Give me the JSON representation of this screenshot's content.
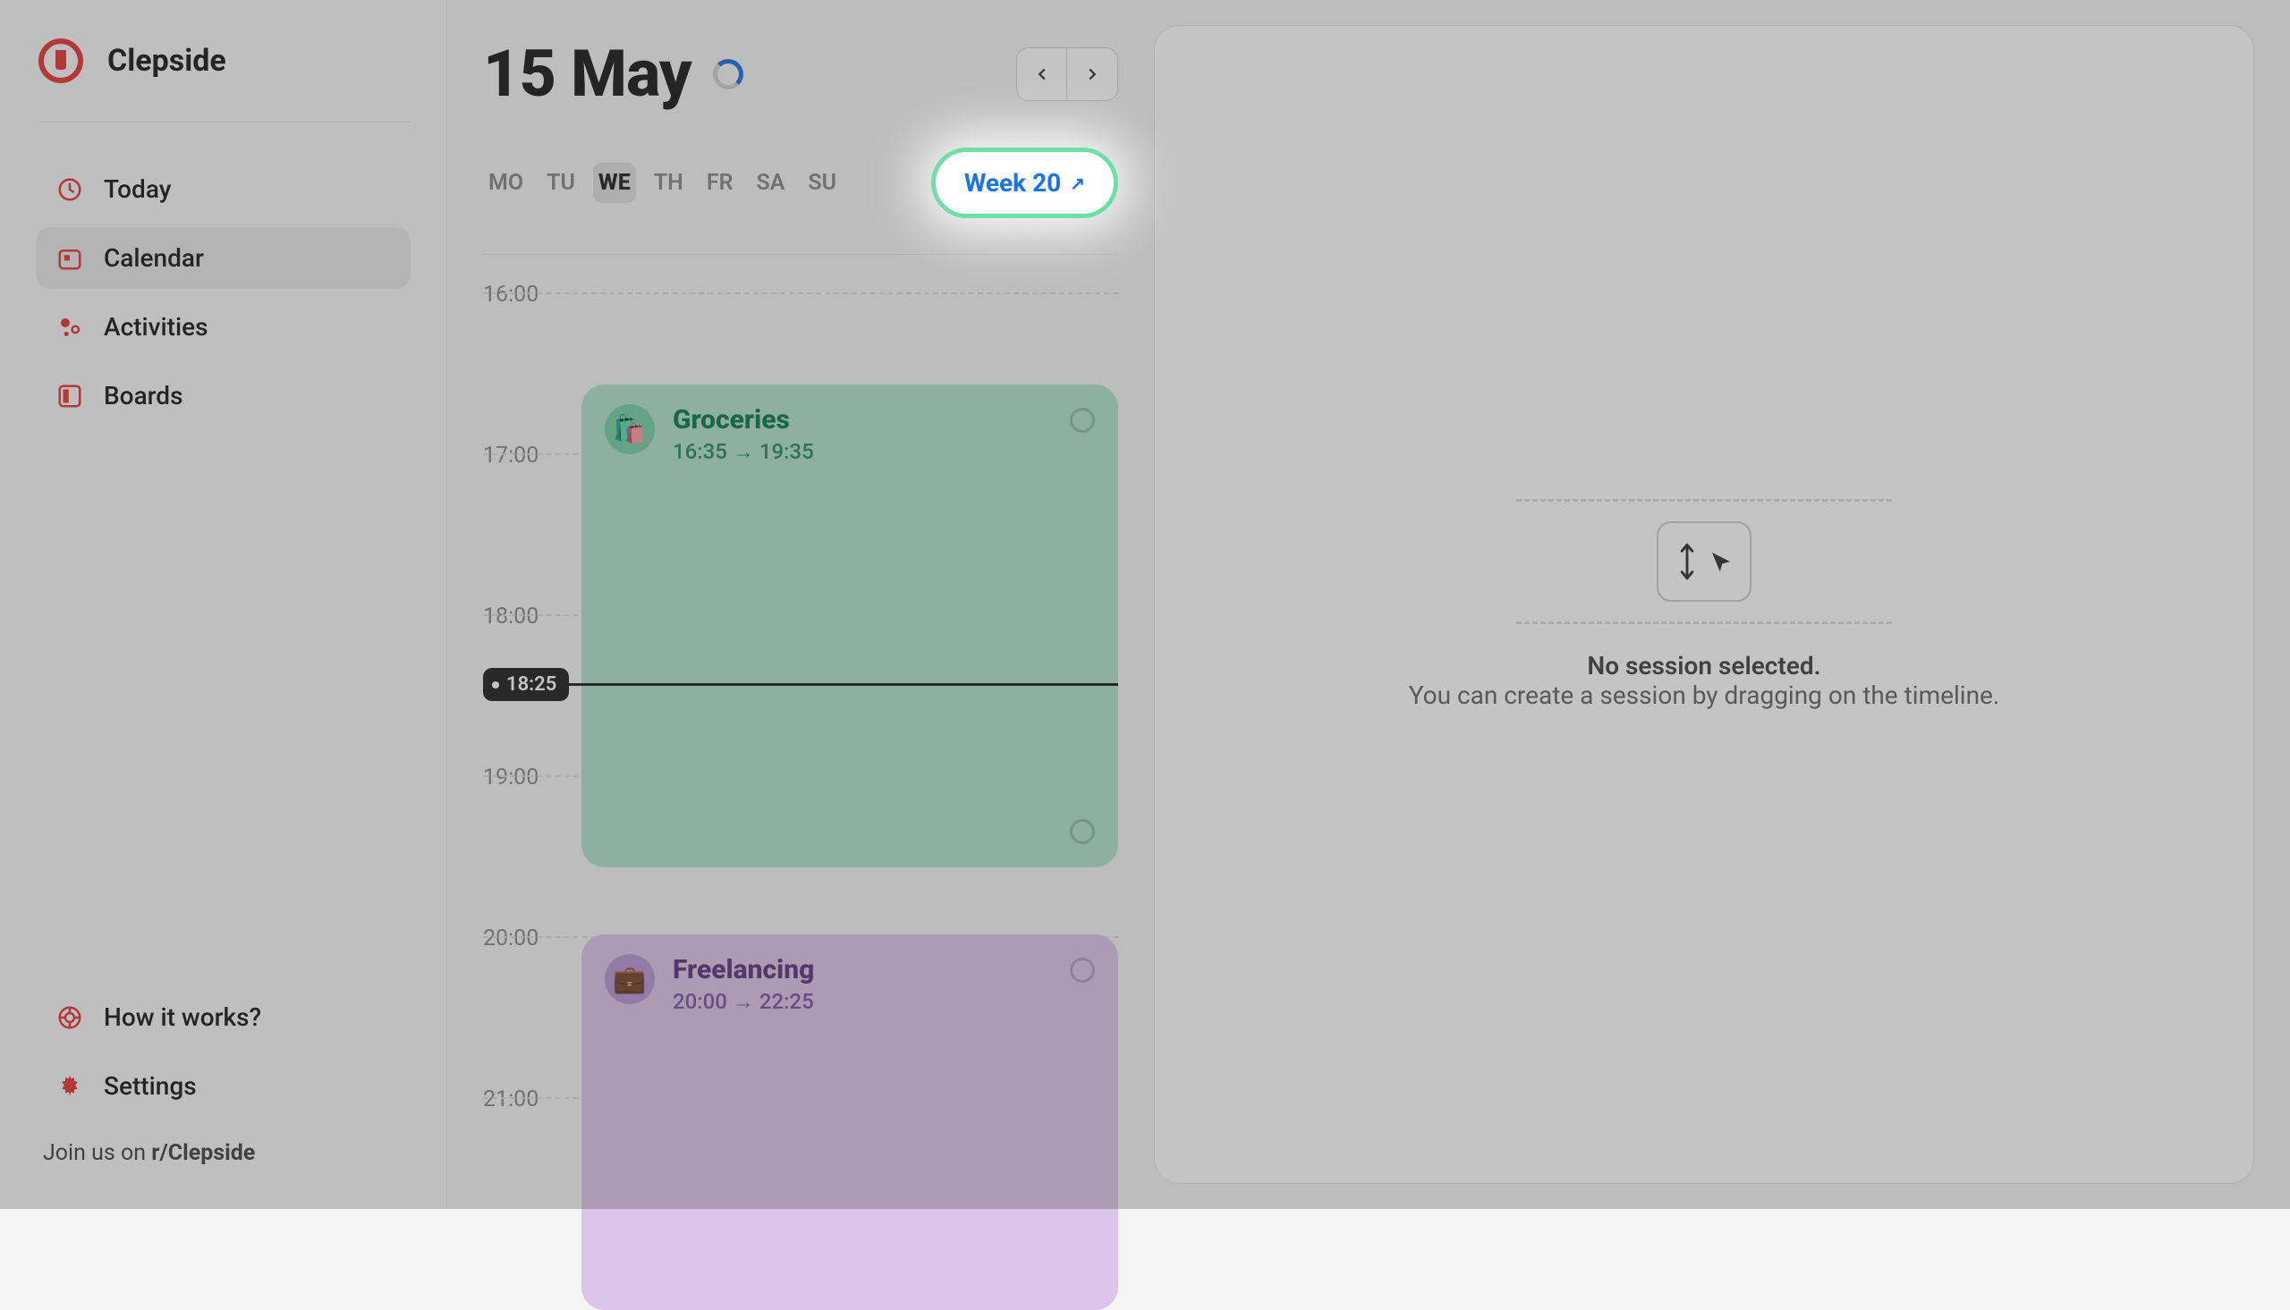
{
  "brand": {
    "name": "Clepside"
  },
  "sidebar": {
    "items": [
      {
        "label": "Today"
      },
      {
        "label": "Calendar"
      },
      {
        "label": "Activities"
      },
      {
        "label": "Boards"
      }
    ],
    "bottom": [
      {
        "label": "How it works?"
      },
      {
        "label": "Settings"
      }
    ],
    "footer_prefix": "Join us on ",
    "footer_link": "r/Clepside"
  },
  "header": {
    "date_title": "15 May",
    "days": [
      "MO",
      "TU",
      "WE",
      "TH",
      "FR",
      "SA",
      "SU"
    ],
    "active_day_index": 2,
    "week_label": "Week 20"
  },
  "timeline": {
    "hours": [
      "16:00",
      "17:00",
      "18:00",
      "19:00",
      "20:00",
      "21:00"
    ],
    "now": "18:25",
    "events": [
      {
        "title": "Groceries",
        "time": "16:35 → 19:35",
        "emoji": "🛍️"
      },
      {
        "title": "Freelancing",
        "time": "20:00 → 22:25",
        "emoji": "💼"
      }
    ]
  },
  "detail": {
    "title": "No session selected.",
    "subtitle": "You can create a session by dragging on the timeline."
  }
}
